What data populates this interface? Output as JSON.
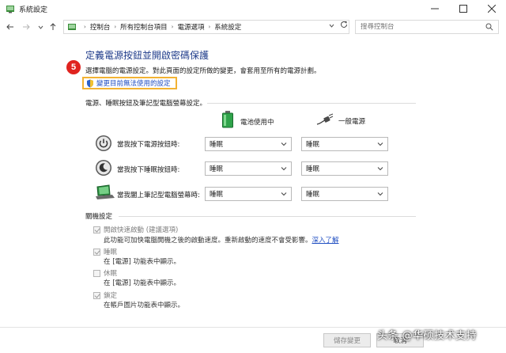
{
  "window": {
    "title": "系統設定",
    "icon": "control-panel-icon"
  },
  "addressbar": {
    "crumbs": [
      "控制台",
      "所有控制台項目",
      "電源選項",
      "系統設定"
    ],
    "search_placeholder": "搜尋控制台"
  },
  "content": {
    "heading": "定義電源按鈕並開啟密碼保護",
    "step_number": "5",
    "description": "選擇電腦的電源設定。對此頁面的設定所做的變更，會套用至所有的電源計劃。",
    "change_link": "變更目前無法使用的設定",
    "buttons_section_label": "電源、睡眠按鈕及筆記型電腦螢幕設定。",
    "col_battery": "電池使用中",
    "col_plugged": "一般電源",
    "rows": [
      {
        "label": "當我按下電源按鈕時:",
        "battery": "睡眠",
        "plugged": "睡眠",
        "icon": "power-button-icon"
      },
      {
        "label": "當我按下睡眠按鈕時:",
        "battery": "睡眠",
        "plugged": "睡眠",
        "icon": "sleep-button-icon"
      },
      {
        "label": "當我闔上筆記型電腦螢幕時:",
        "battery": "睡眠",
        "plugged": "睡眠",
        "icon": "laptop-lid-icon"
      }
    ],
    "shutdown_section_label": "關機設定",
    "shutdown": [
      {
        "label": "開啟快速啟動 (建議選項)",
        "checked": true,
        "desc": "此功能可加快電腦開機之後的啟動速度。重新啟動的速度不會受影響。",
        "link": "深入了解"
      },
      {
        "label": "睡眠",
        "checked": true,
        "desc": "在 [電源] 功能表中顯示。"
      },
      {
        "label": "休眠",
        "checked": false,
        "desc": "在 [電源] 功能表中顯示。"
      },
      {
        "label": "鎖定",
        "checked": true,
        "desc": "在帳戶圖片功能表中顯示。"
      }
    ]
  },
  "footer": {
    "save_label": "儲存變更",
    "cancel_label": "取消"
  },
  "watermark": "头条 @华硕技术支持",
  "colors": {
    "heading": "#1e3b8a",
    "link": "#1f4ec2",
    "highlight_border": "#f2b233",
    "badge": "#e0231f"
  }
}
